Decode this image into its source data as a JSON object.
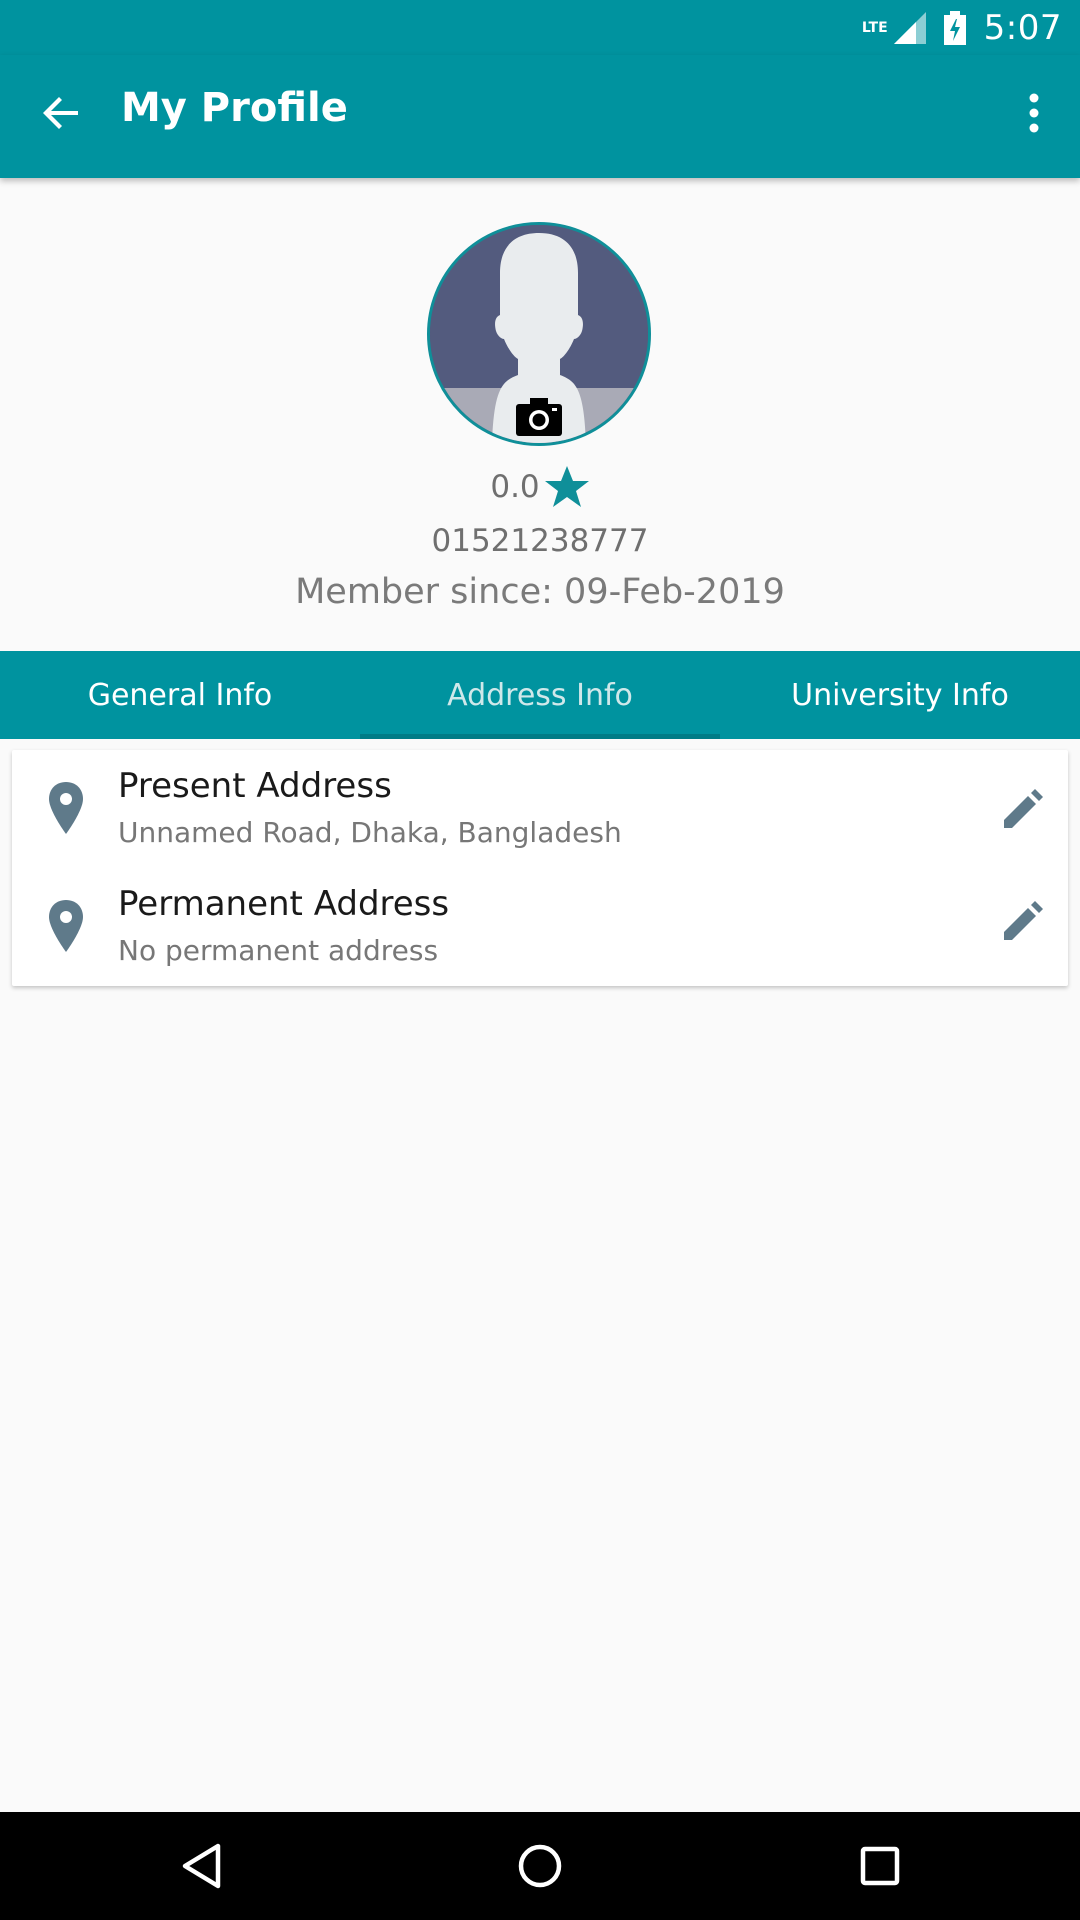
{
  "status_bar": {
    "network": "LTE",
    "time": "5:07"
  },
  "app_bar": {
    "title": "My Profile",
    "back_icon": "arrow-back-icon",
    "menu_icon": "more-vert-icon"
  },
  "profile": {
    "rating": "0.0",
    "rating_icon": "star-icon",
    "phone": "01521238777",
    "member_label": "Member since:",
    "member_date": "09-Feb-2019"
  },
  "tabs": [
    {
      "label": "General Info",
      "active": false
    },
    {
      "label": "Address Info",
      "active": true
    },
    {
      "label": "University Info",
      "active": false
    }
  ],
  "addresses": [
    {
      "title": "Present Address",
      "value": "Unnamed Road, Dhaka, Bangladesh"
    },
    {
      "title": "Permanent Address",
      "value": "No permanent address"
    }
  ],
  "colors": {
    "primary": "#00939f",
    "icon_grey": "#5f7a8a",
    "star": "#0f8f99"
  }
}
